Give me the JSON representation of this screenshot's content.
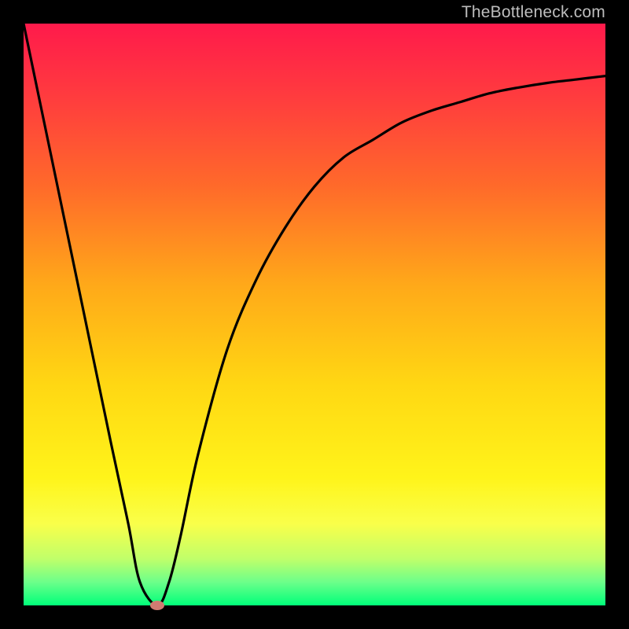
{
  "watermark": "TheBottleneck.com",
  "chart_data": {
    "type": "line",
    "title": "",
    "xlabel": "",
    "ylabel": "",
    "xlim": [
      0,
      100
    ],
    "ylim": [
      0,
      100
    ],
    "grid": false,
    "legend": null,
    "annotations": [],
    "series": [
      {
        "name": "curve",
        "x": [
          0,
          5,
          10,
          15,
          18,
          20,
          23,
          25,
          27,
          30,
          35,
          40,
          45,
          50,
          55,
          60,
          65,
          70,
          75,
          80,
          85,
          90,
          95,
          100
        ],
        "y": [
          100,
          76,
          52,
          28,
          14,
          4,
          0,
          4,
          12,
          26,
          44,
          56,
          65,
          72,
          77,
          80,
          83,
          85,
          86.5,
          88,
          89,
          89.8,
          90.4,
          91
        ]
      }
    ],
    "marker": {
      "x": 23,
      "y": 0
    },
    "background_gradient": {
      "direction": "vertical",
      "stops": [
        {
          "pos": 0,
          "color": "#ff1a4b"
        },
        {
          "pos": 0.12,
          "color": "#ff3a3f"
        },
        {
          "pos": 0.28,
          "color": "#ff6a2a"
        },
        {
          "pos": 0.45,
          "color": "#ffa919"
        },
        {
          "pos": 0.62,
          "color": "#ffd713"
        },
        {
          "pos": 0.78,
          "color": "#fff41a"
        },
        {
          "pos": 0.86,
          "color": "#f9ff4a"
        },
        {
          "pos": 0.92,
          "color": "#c0ff6a"
        },
        {
          "pos": 0.96,
          "color": "#6cff8a"
        },
        {
          "pos": 1.0,
          "color": "#00ff7a"
        }
      ]
    }
  }
}
